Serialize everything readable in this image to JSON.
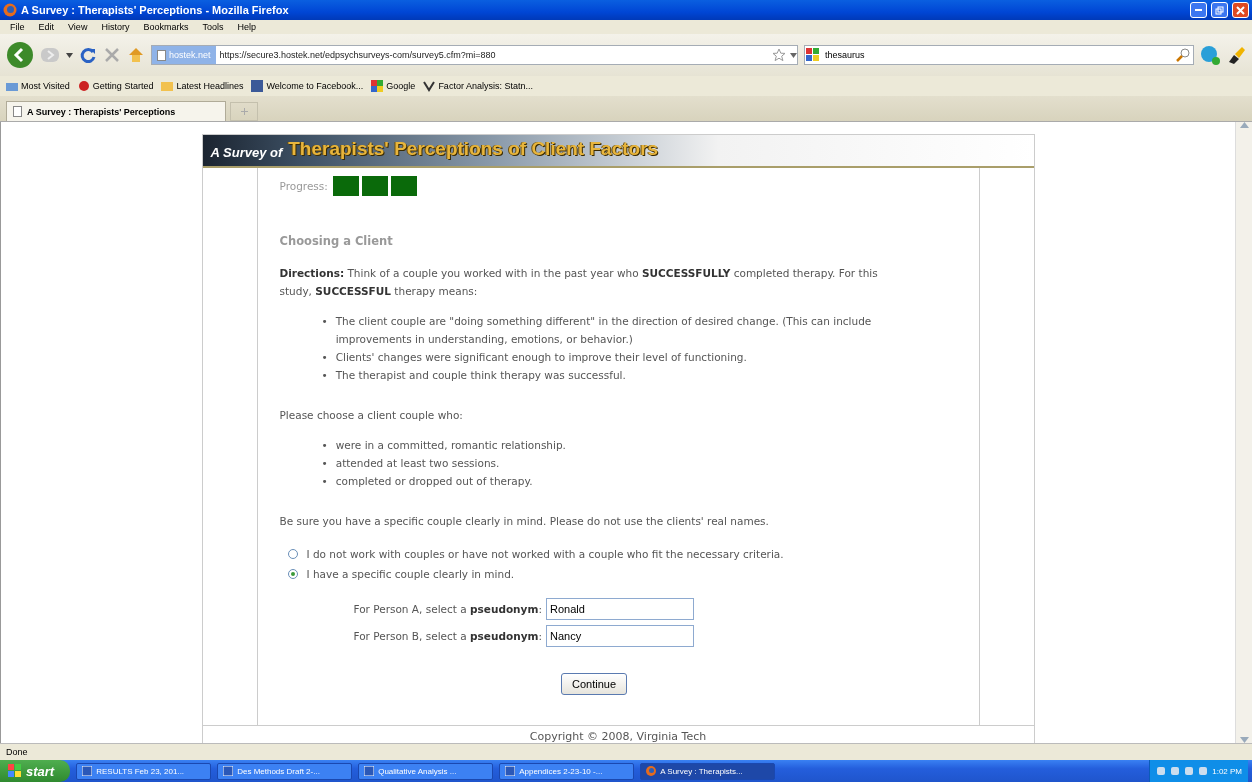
{
  "window": {
    "title": "A Survey : Therapists' Perceptions - Mozilla Firefox"
  },
  "menu": [
    "File",
    "Edit",
    "View",
    "History",
    "Bookmarks",
    "Tools",
    "Help"
  ],
  "address_bar": {
    "site_label": "hostek.net",
    "url": "https://secure3.hostek.net/edpsychsurveys-com/survey5.cfm?mi=880"
  },
  "search_field": {
    "value": "thesaurus"
  },
  "bookmarks": [
    "Most Visited",
    "Getting Started",
    "Latest Headlines",
    "Welcome to Facebook...",
    "Google",
    "Factor Analysis: Statn..."
  ],
  "tabs": [
    {
      "label": "A Survey : Therapists' Perceptions",
      "selected": true
    }
  ],
  "survey": {
    "banner_prefix": "A Survey of",
    "banner_title": "Therapists' Perceptions of Client Factors",
    "progress_label": "Progress:",
    "bullet": "•",
    "progress_segments": [
      {
        "filled": true
      },
      {
        "filled": true
      },
      {
        "filled": true
      }
    ],
    "heading": "Choosing a Client",
    "directions": "**Directions:** Think of a couple you worked with in the past year who **SUCCESSFULLY** completed therapy. For this study, **SUCCESSFUL** therapy means:",
    "criteria": [
      "The client couple are \"doing something different\" in the direction of desired change. (This can include improvements in understanding, emotions, or behavior.)",
      "Clients' changes were significant enough to improve their level of functioning.",
      "The therapist and couple think therapy was successful."
    ],
    "choose_prompt": "Please choose a client couple who:",
    "requirements": [
      "were in a committed, romantic relationship.",
      "attended at least two sessions.",
      "completed or dropped out of therapy."
    ],
    "note": "Be sure you have a specific couple clearly in mind. Please do not use the clients' real names.",
    "options": [
      {
        "label": "I do not work with couples or have not worked with a couple who fit the necessary criteria.",
        "selected": false
      },
      {
        "label": "I have a specific couple clearly in mind.",
        "selected": true
      }
    ],
    "pseudonyms": [
      {
        "label": "For Person A, select a **pseudonym**:",
        "value": "Ronald"
      },
      {
        "label": "For Person B, select a **pseudonym**:",
        "value": "Nancy"
      }
    ],
    "continue_button": "Continue",
    "copyright": "Copyright © 2008, Virginia Tech"
  },
  "status_bar": "Done",
  "taskbar": {
    "start": "start",
    "tasks": [
      {
        "label": "RESULTS Feb 23, 201...",
        "selected": false
      },
      {
        "label": "Des Methods Draft 2-...",
        "selected": false
      },
      {
        "label": "Qualitative Analysis ...",
        "selected": false
      },
      {
        "label": "Appendices 2-23-10 -...",
        "selected": false
      },
      {
        "label": "A Survey : Therapists...",
        "selected": true
      }
    ],
    "clock": "1:02 PM"
  }
}
